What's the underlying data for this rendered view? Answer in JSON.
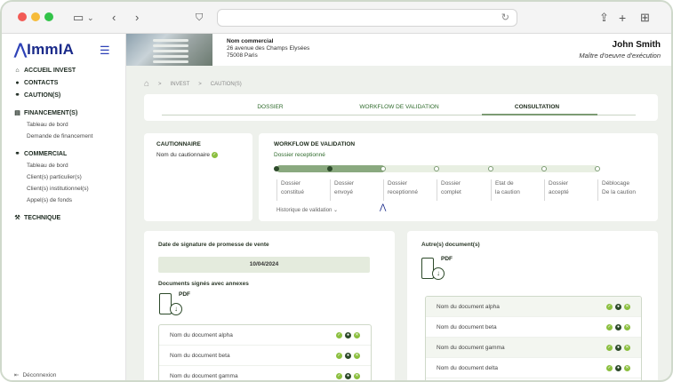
{
  "browser": {
    "back_icon": "chevron-left-icon",
    "forward_icon": "chevron-right-icon"
  },
  "sidebar": {
    "logo": "ImmIA",
    "items": [
      {
        "label": "ACCUEIL INVEST",
        "icon": "home-icon",
        "subs": []
      },
      {
        "label": "CONTACTS",
        "icon": "user-icon",
        "subs": []
      },
      {
        "label": "CAUTION(S)",
        "icon": "handshake-icon",
        "subs": []
      },
      {
        "label": "FINANCEMENT(S)",
        "icon": "document-icon",
        "subs": [
          "Tableau de bord",
          "Demande de financement"
        ]
      },
      {
        "label": "COMMERCIAL",
        "icon": "handshake-icon",
        "subs": [
          "Tableau de bord",
          "Client(s) particulier(s)",
          "Client(s) institutionnel(s)",
          "Appel(s) de fonds"
        ]
      },
      {
        "label": "TECHNIQUE",
        "icon": "tools-icon",
        "subs": []
      }
    ],
    "logout": "Déconnexion"
  },
  "header": {
    "project_title": "Nom commercial",
    "address1": "26 avenue des Champs Elysées",
    "address2": "75008 Paris",
    "user_name": "John Smith",
    "user_role": "Maître d'oeuvre d'exécution"
  },
  "breadcrumb": [
    "INVEST",
    "CAUTION(S)"
  ],
  "tabs": [
    "DOSSIER",
    "WORKFLOW DE VALIDATION",
    "CONSULTATION"
  ],
  "cautionnaire": {
    "title": "CAUTIONNAIRE",
    "name": "Nom du cautionnaire"
  },
  "workflow": {
    "title": "WORKFLOW DE VALIDATION",
    "status": "Dossier receptionné",
    "steps": [
      {
        "l1": "Dossier",
        "l2": "constitué",
        "done": true
      },
      {
        "l1": "Dossier",
        "l2": "envoyé",
        "done": true
      },
      {
        "l1": "Dossier",
        "l2": "receptionné",
        "done": false
      },
      {
        "l1": "Dossier",
        "l2": "complet",
        "done": false
      },
      {
        "l1": "Etat de",
        "l2": "la caution",
        "done": false
      },
      {
        "l1": "Dossier",
        "l2": "accepté",
        "done": false
      },
      {
        "l1": "Déblocage",
        "l2": "De la caution",
        "done": false
      }
    ],
    "history": "Historique de validation"
  },
  "signature": {
    "title": "Date de signature de promesse de vente",
    "date": "10/04/2024",
    "docs_title": "Documents signés avec annexes",
    "pdf_label": "PDF",
    "docs": [
      "Nom du document alpha",
      "Nom du document beta",
      "Nom du document gamma"
    ]
  },
  "others": {
    "title": "Autre(s) document(s)",
    "pdf_label": "PDF",
    "docs": [
      "Nom du document alpha",
      "Nom du document beta",
      "Nom du document gamma",
      "Nom du document delta"
    ]
  }
}
